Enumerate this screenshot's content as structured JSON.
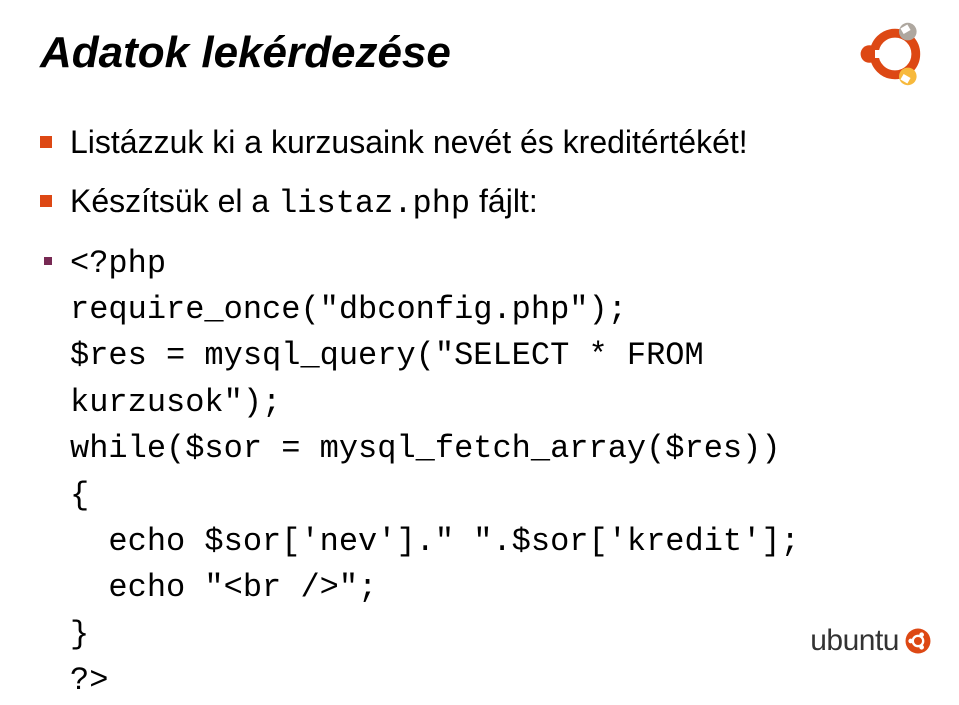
{
  "slide": {
    "title": "Adatok lekérdezése",
    "bullets": [
      {
        "text": "Listázzuk ki a kurzusaink nevét és kreditértékét!",
        "type": "normal"
      },
      {
        "prefix": "Készítsük el a ",
        "code": "listaz.php",
        "suffix": " fájlt:",
        "type": "mixed"
      }
    ],
    "code": "<?php\nrequire_once(\"dbconfig.php\");\n$res = mysql_query(\"SELECT * FROM\nkurzusok\");\nwhile($sor = mysql_fetch_array($res))\n{\n  echo $sor['nev'].\" \".$sor['kredit'];\n  echo \"<br />\";\n}\n?>"
  },
  "footer": {
    "brand": "ubuntu"
  },
  "icons": {
    "logo": "ubuntu-logo-icon"
  }
}
